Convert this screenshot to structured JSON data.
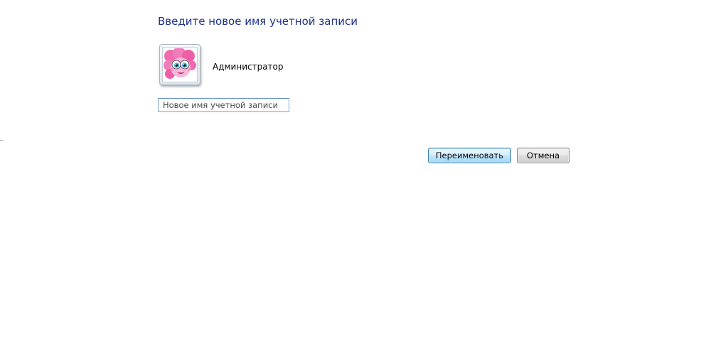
{
  "dialog": {
    "title": "Введите новое имя учетной записи"
  },
  "account": {
    "name": "Администратор",
    "avatar_icon": "pony-avatar-icon"
  },
  "new_name_field": {
    "value": "",
    "placeholder": "Новое имя учетной записи"
  },
  "actions": {
    "rename_label": "Переименовать",
    "cancel_label": "Отмена"
  },
  "colors": {
    "title": "#1e3287",
    "input_border": "#7aa6cf",
    "primary_button_border": "#3c7fb1",
    "avatar_pink": "#f06ab0"
  }
}
